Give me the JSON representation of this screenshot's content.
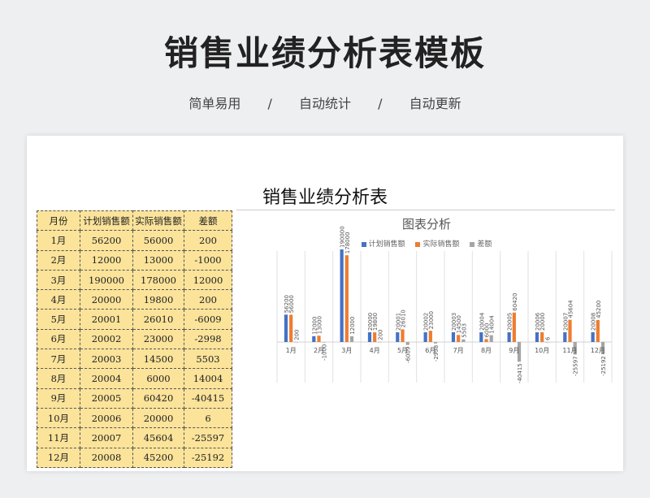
{
  "page": {
    "title": "销售业绩分析表模板",
    "taglines": [
      "简单易用",
      "/",
      "自动统计",
      "/",
      "自动更新"
    ]
  },
  "sheet": {
    "title": "销售业绩分析表",
    "table": {
      "headers": [
        "月份",
        "计划销售额",
        "实际销售额",
        "差额"
      ],
      "rows": [
        [
          "1月",
          "56200",
          "56000",
          "200"
        ],
        [
          "2月",
          "12000",
          "13000",
          "-1000"
        ],
        [
          "3月",
          "190000",
          "178000",
          "12000"
        ],
        [
          "4月",
          "20000",
          "19800",
          "200"
        ],
        [
          "5月",
          "20001",
          "26010",
          "-6009"
        ],
        [
          "6月",
          "20002",
          "23000",
          "-2998"
        ],
        [
          "7月",
          "20003",
          "14500",
          "5503"
        ],
        [
          "8月",
          "20004",
          "6000",
          "14004"
        ],
        [
          "9月",
          "20005",
          "60420",
          "-40415"
        ],
        [
          "10月",
          "20006",
          "20000",
          "6"
        ],
        [
          "11月",
          "20007",
          "45604",
          "-25597"
        ],
        [
          "12月",
          "20008",
          "45200",
          "-25192"
        ]
      ]
    }
  },
  "colors": {
    "plan": "#4472c4",
    "actual": "#ed7d31",
    "diff": "#a5a5a5",
    "table_bg": "#fbe39a"
  },
  "chart_data": {
    "type": "bar",
    "title": "图表分析",
    "categories": [
      "1月",
      "2月",
      "3月",
      "4月",
      "5月",
      "6月",
      "7月",
      "8月",
      "9月",
      "10月",
      "11月",
      "12月"
    ],
    "series": [
      {
        "name": "计划销售额",
        "values": [
          56200,
          12000,
          190000,
          20000,
          20001,
          20002,
          20003,
          20004,
          20005,
          20006,
          20007,
          20008
        ]
      },
      {
        "name": "实际销售额",
        "values": [
          56000,
          13000,
          178000,
          19800,
          26010,
          23000,
          14500,
          6000,
          60420,
          20000,
          45604,
          45200
        ]
      },
      {
        "name": "差额",
        "values": [
          200,
          -1000,
          12000,
          200,
          -6009,
          -2998,
          5503,
          14004,
          -40415,
          6,
          -25597,
          -25192
        ]
      }
    ],
    "legend_position": "top",
    "grid": false
  }
}
